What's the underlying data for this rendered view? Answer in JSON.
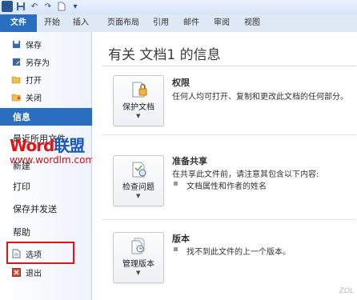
{
  "quick_access": {
    "app_icon": "word-icon",
    "app_letter": "W"
  },
  "ribbon": {
    "tabs": [
      "文件",
      "开始",
      "插入",
      "页面布局",
      "引用",
      "邮件",
      "审阅",
      "视图"
    ]
  },
  "backstage": {
    "items": [
      {
        "label": "保存",
        "icon": "save-icon"
      },
      {
        "label": "另存为",
        "icon": "save-as-icon"
      },
      {
        "label": "打开",
        "icon": "open-folder-icon"
      },
      {
        "label": "关闭",
        "icon": "close-folder-icon"
      }
    ],
    "active": "信息",
    "recent": "最近所用文件",
    "new": "新建",
    "print": "打印",
    "save_send": "保存并发送",
    "help": "帮助",
    "options": "选项",
    "exit": "退出"
  },
  "watermark": {
    "word": "Word",
    "cn": "联盟",
    "url": "www.wordlm.com"
  },
  "info": {
    "title": "有关 文档1 的信息",
    "permissions": {
      "button": "保护文档",
      "heading": "权限",
      "description": "任何人均可打开、复制和更改此文档的任何部分。"
    },
    "prepare": {
      "button": "检查问题",
      "heading": "准备共享",
      "description": "在共享此文件前，请注意其包含以下内容:",
      "bullet": "文档属性和作者的姓名"
    },
    "versions": {
      "button": "管理版本",
      "heading": "版本",
      "description": "找不到此文件的上一个版本。"
    }
  },
  "colors": {
    "file_tab": "#2a6ebf",
    "highlight": "#e0151b",
    "watermark_red": "#c8101a"
  }
}
